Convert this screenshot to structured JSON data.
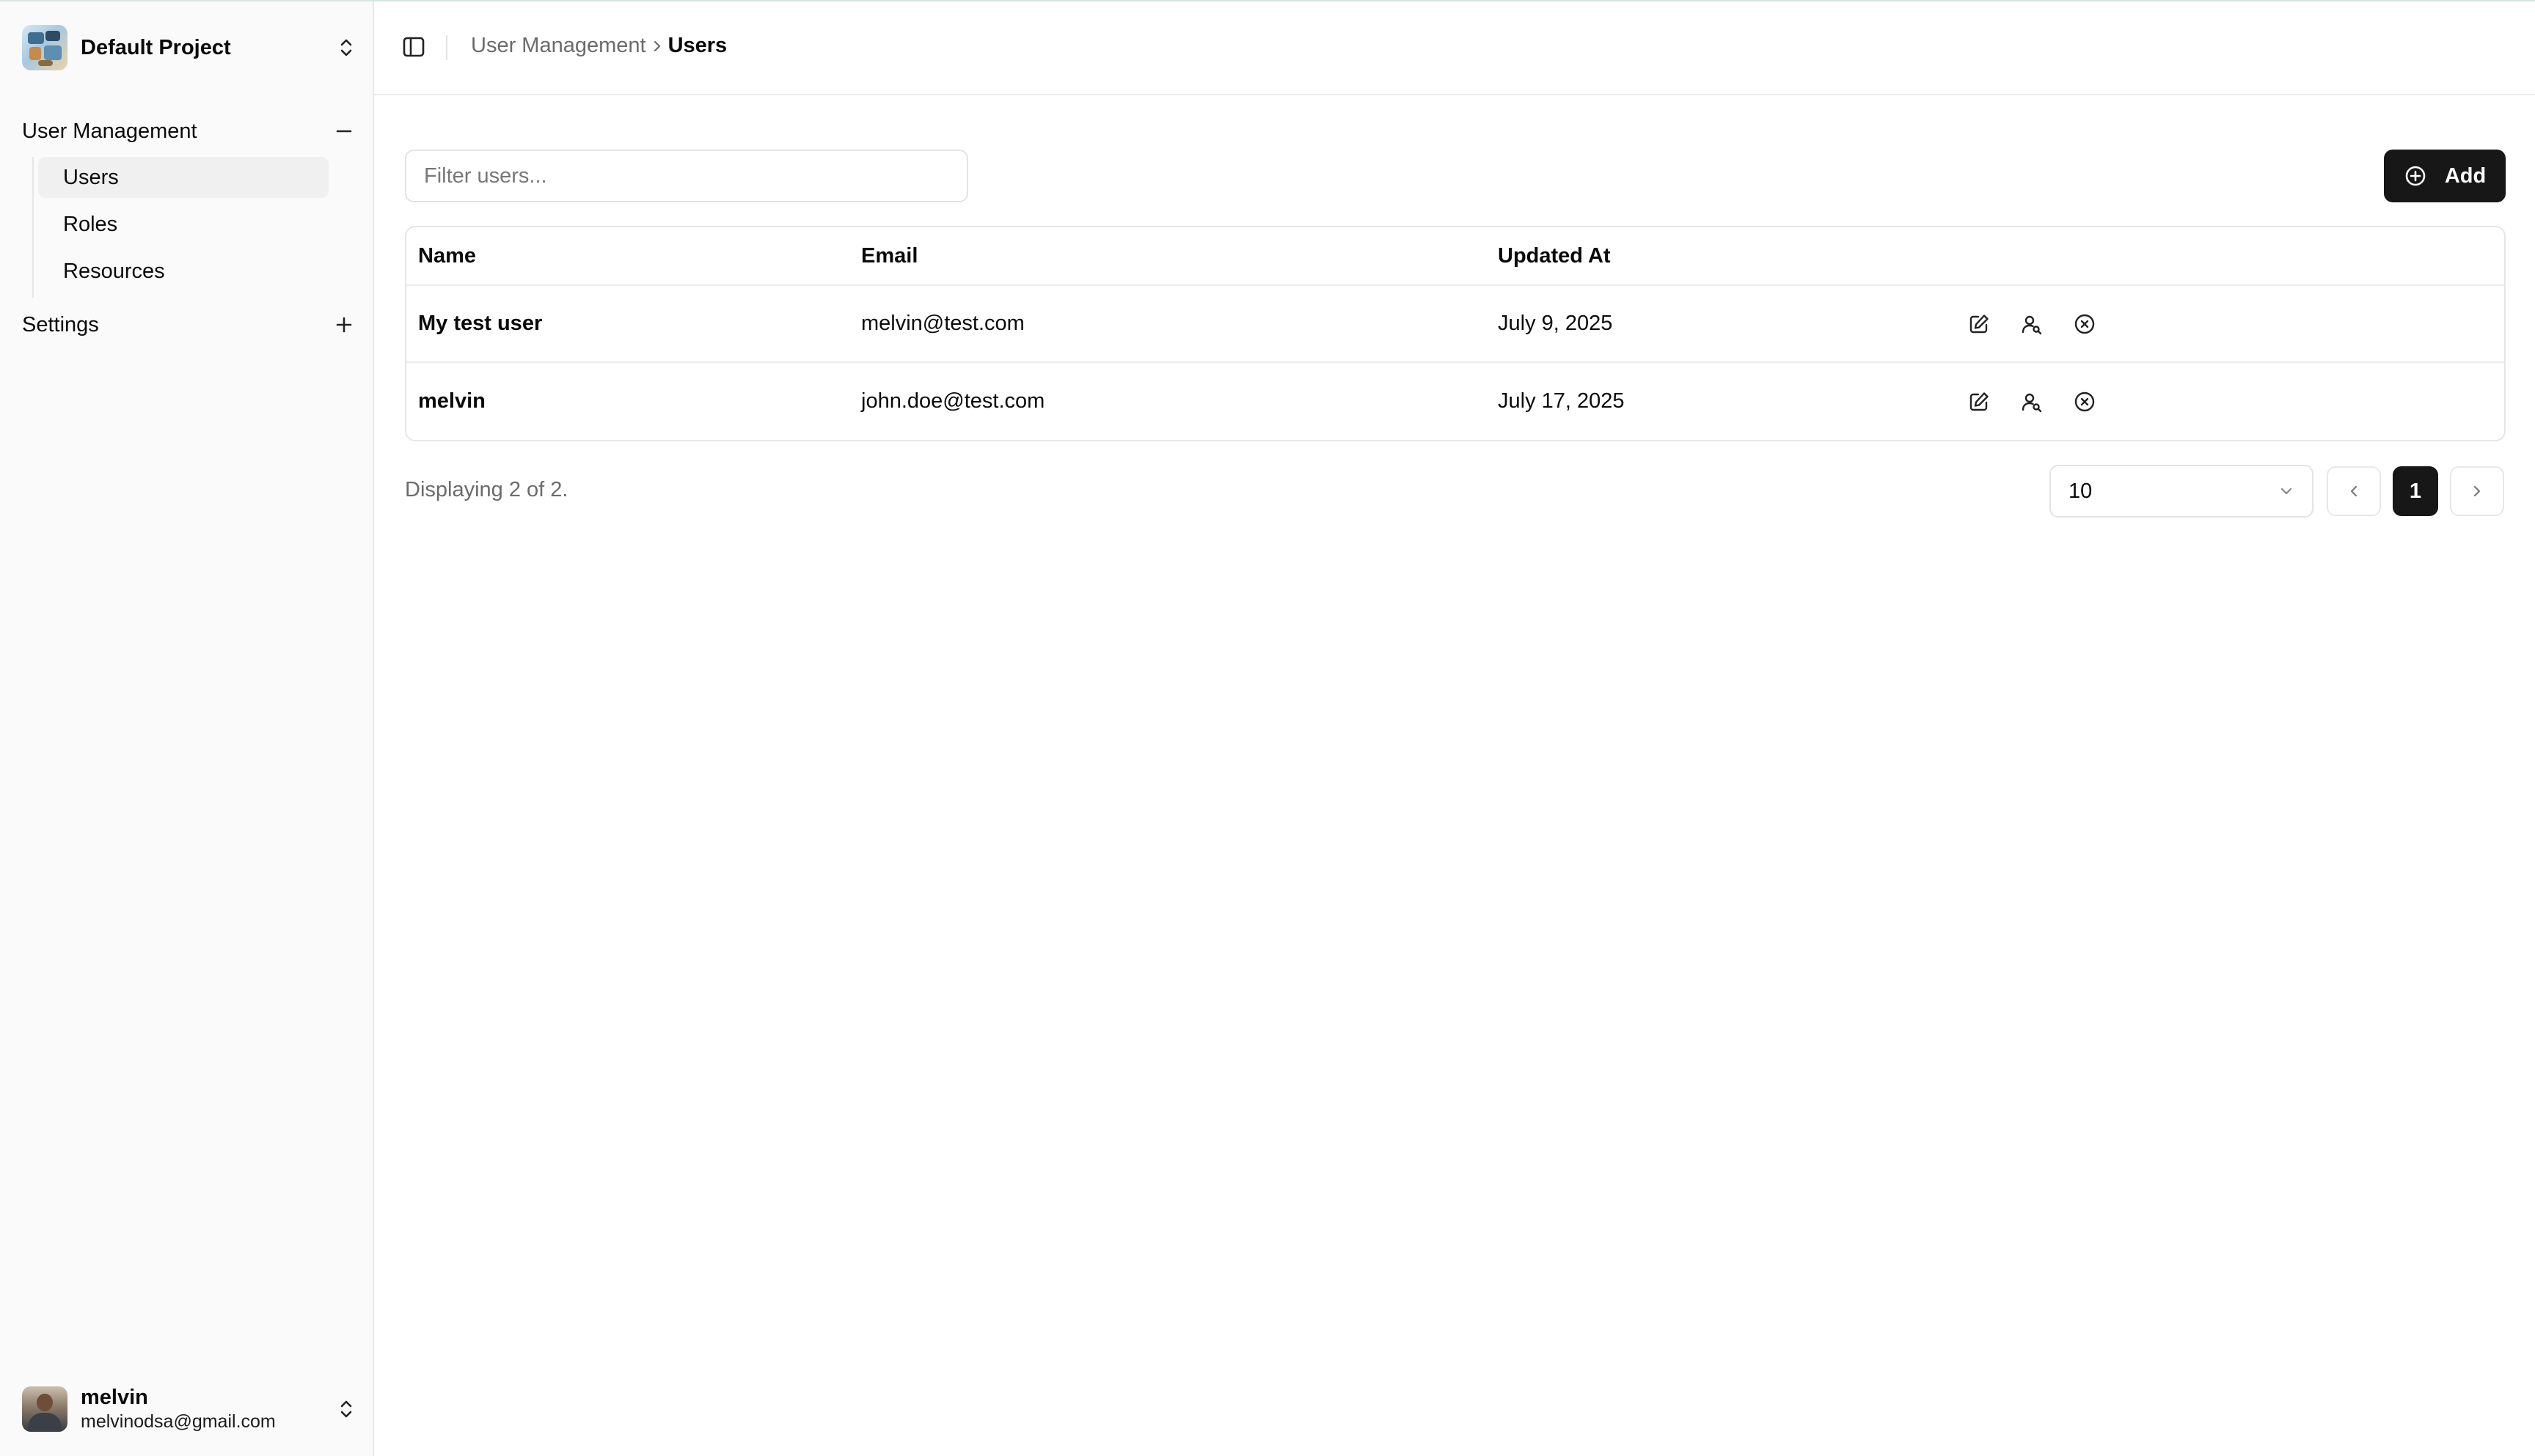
{
  "project": {
    "name": "Default Project",
    "logo_icon": "project-logo-icon"
  },
  "sidebar": {
    "groups": [
      {
        "label": "User Management",
        "toggle_icon": "minus-icon",
        "expanded": true,
        "items": [
          {
            "label": "Users",
            "active": true
          },
          {
            "label": "Roles",
            "active": false
          },
          {
            "label": "Resources",
            "active": false
          }
        ]
      },
      {
        "label": "Settings",
        "toggle_icon": "plus-icon",
        "expanded": false,
        "items": []
      }
    ]
  },
  "current_user": {
    "name": "melvin",
    "email": "melvinodsa@gmail.com"
  },
  "header": {
    "breadcrumb": [
      {
        "label": "User Management",
        "current": false
      },
      {
        "label": "Users",
        "current": true
      }
    ]
  },
  "toolbar": {
    "filter_placeholder": "Filter users...",
    "filter_value": "",
    "add_label": "Add",
    "add_icon": "plus-circle-icon"
  },
  "table": {
    "columns": [
      "Name",
      "Email",
      "Updated At",
      ""
    ],
    "rows": [
      {
        "name": "My test user",
        "email": "melvin@test.com",
        "updated_at": "July 9, 2025"
      },
      {
        "name": "melvin",
        "email": "john.doe@test.com",
        "updated_at": "July 17, 2025"
      }
    ],
    "row_actions": [
      "edit-icon",
      "user-search-icon",
      "x-circle-icon"
    ]
  },
  "pagination": {
    "summary": "Displaying 2 of 2.",
    "page_size": "10",
    "current_page": "1"
  },
  "colors": {
    "primary": "#171717",
    "sidebar_bg": "#fafafa",
    "border": "#e6e6e6",
    "muted_text": "#6b6b6b"
  }
}
